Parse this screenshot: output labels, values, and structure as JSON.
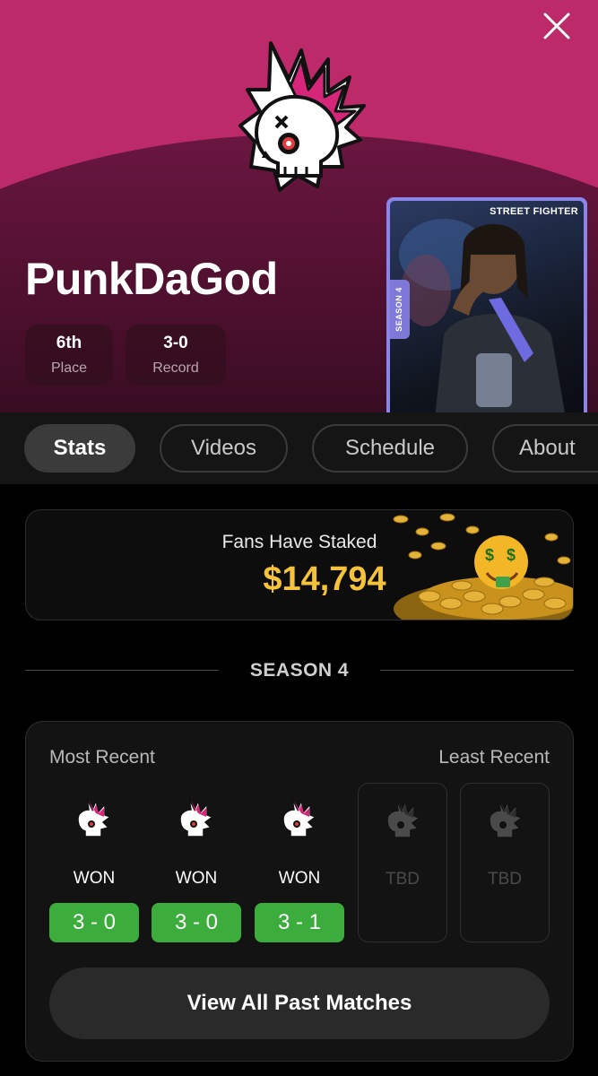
{
  "player": {
    "name": "PunkDaGod",
    "place_value": "6th",
    "place_label": "Place",
    "record_value": "3-0",
    "record_label": "Record"
  },
  "card": {
    "tag": "STREET FIGHTER",
    "season": "SEASON 4"
  },
  "tabs": [
    {
      "label": "Stats",
      "active": true
    },
    {
      "label": "Videos",
      "active": false
    },
    {
      "label": "Schedule",
      "active": false
    },
    {
      "label": "About",
      "active": false
    }
  ],
  "stake": {
    "label": "Fans Have Staked",
    "amount": "$14,794"
  },
  "season": {
    "title": "SEASON 4",
    "most_recent_label": "Most Recent",
    "least_recent_label": "Least Recent",
    "matches": [
      {
        "result": "WON",
        "score": "3 - 0",
        "status": "played"
      },
      {
        "result": "WON",
        "score": "3 - 0",
        "status": "played"
      },
      {
        "result": "WON",
        "score": "3 - 1",
        "status": "played"
      },
      {
        "result": "TBD",
        "score": "",
        "status": "tbd"
      },
      {
        "result": "TBD",
        "score": "",
        "status": "tbd"
      }
    ],
    "view_all_label": "View All Past Matches"
  },
  "colors": {
    "brand_pink": "#bd2a6a",
    "win_green": "#3cad3c",
    "amount_gold": "#f5c23c",
    "card_frame": "#8a86e8"
  },
  "icons": {
    "close": "close-icon",
    "team_logo": "punk-skull-logo-icon",
    "match_logo": "punk-skull-icon",
    "coins": "coin-pile-icon"
  }
}
